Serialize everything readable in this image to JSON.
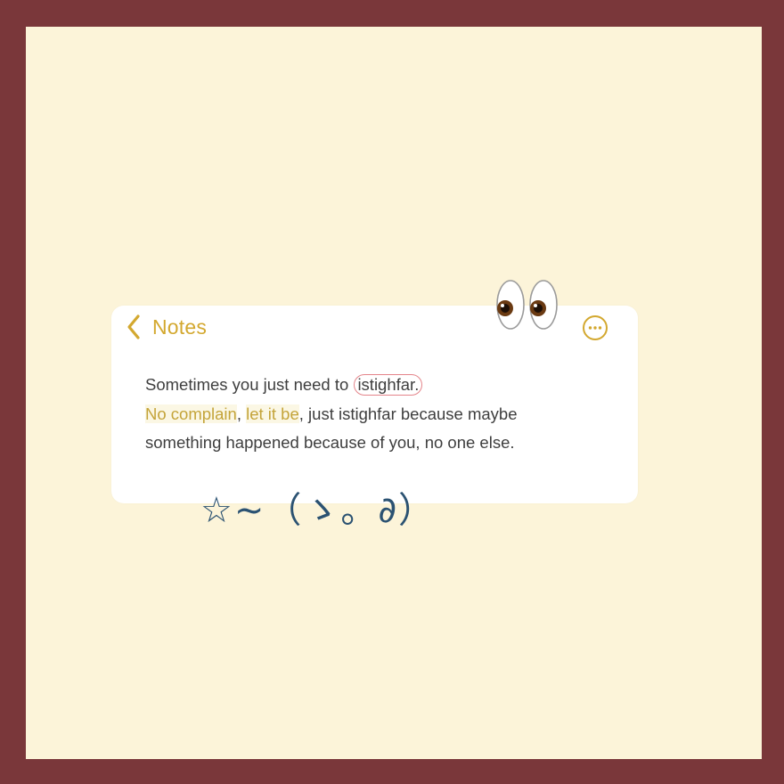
{
  "header": {
    "back_label": "Notes",
    "back_icon": "chevron-left-icon",
    "more_icon": "ellipsis-circle-icon",
    "eyes_icon": "eyes-emoji-icon"
  },
  "note": {
    "line1_text": "Sometimes you just need to ",
    "line1_circled": "istighfar.",
    "line2_part1": "No complain",
    "line2_comma1": ", ",
    "line2_part2": "let it be",
    "line2_rest": ", just istighfar because maybe",
    "line3": "something happened because of you, no one else."
  },
  "decoration": {
    "kaomoji": "☆~（ゝ。∂）"
  },
  "colors": {
    "frame": "#7a373a",
    "background": "#fcf4d9",
    "accent": "#d3a82f",
    "circle": "#e4848a",
    "kaomoji": "#2b5272"
  }
}
